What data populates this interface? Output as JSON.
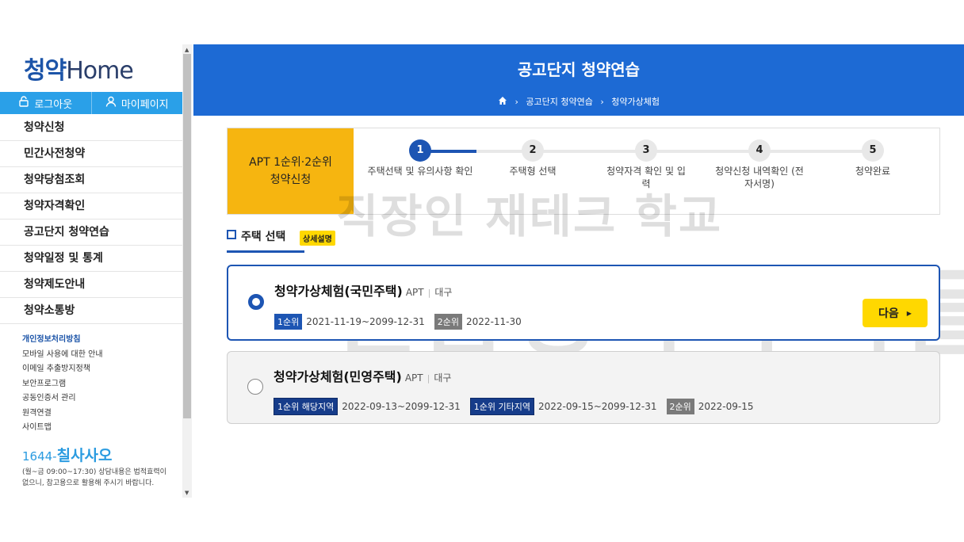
{
  "sidebar": {
    "logo_ko": "청약",
    "logo_en": "Home",
    "logout_label": "로그아웃",
    "mypage_label": "마이페이지",
    "menu": [
      "청약신청",
      "민간사전청약",
      "청약당첨조회",
      "청약자격확인",
      "공고단지 청약연습",
      "청약일정 및 통계",
      "청약제도안내",
      "청약소통방"
    ],
    "links": [
      "개인정보처리방침",
      "모바일 사용에 대한 안내",
      "이메일 추출방지정책",
      "보안프로그램",
      "공동인증서 관리",
      "원격연결",
      "사이트맵"
    ],
    "phone_prefix": "1644-",
    "phone_main": "칠사사오",
    "phone_note": "(월~금 09:00~17:30) 상담내용은 법적효력이 없으니, 참고용으로 활용해 주시기 바랍니다."
  },
  "header": {
    "title": "공고단지 청약연습",
    "breadcrumb": [
      "공고단지 청약연습",
      "청약가상체험"
    ]
  },
  "steps": {
    "label_line1": "APT 1순위·2순위",
    "label_line2": "청약신청",
    "items": [
      {
        "num": "1",
        "label": "주택선택 및 유의사항 확인"
      },
      {
        "num": "2",
        "label": "주택형 선택"
      },
      {
        "num": "3",
        "label": "청약자격 확인 및 입력"
      },
      {
        "num": "4",
        "label": "청약신청 내역확인 (전자서명)"
      },
      {
        "num": "5",
        "label": "청약완료"
      }
    ],
    "active_step": 1
  },
  "section": {
    "title": "주택 선택",
    "detail_badge": "상세설명"
  },
  "options": [
    {
      "title": "청약가상체험(국민주택)",
      "type": "APT",
      "region": "대구",
      "selected": true,
      "ranks": [
        {
          "label": "1순위",
          "date": "2021-11-19~2099-12-31"
        },
        {
          "label": "2순위",
          "date": "2022-11-30"
        }
      ]
    },
    {
      "title": "청약가상체험(민영주택)",
      "type": "APT",
      "region": "대구",
      "selected": false,
      "ranks": [
        {
          "label": "1순위 해당지역",
          "date": "2022-09-13~2099-12-31"
        },
        {
          "label": "1순위 기타지역",
          "date": "2022-09-15~2099-12-31"
        },
        {
          "label": "2순위",
          "date": "2022-09-15"
        }
      ]
    }
  ],
  "next_label": "다음",
  "watermark": {
    "line1": "직장인 재테크 학교",
    "line2": "월급쟁이 부자들"
  }
}
